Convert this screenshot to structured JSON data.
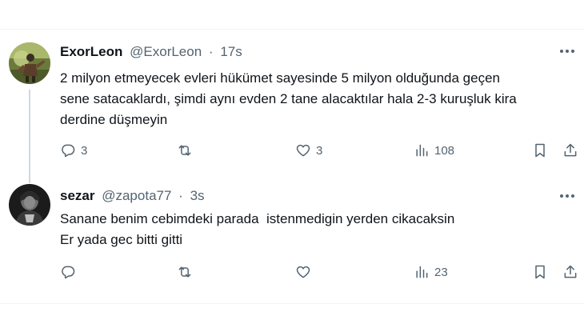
{
  "tweets": [
    {
      "name": "ExorLeon",
      "handle": "@ExorLeon",
      "separator": "·",
      "time": "17s",
      "text_lines": [
        "2 milyon etmeyecek evleri hükümet sayesinde 5 milyon olduğunda geçen",
        "sene satacaklardı, şimdi aynı evden 2 tane alacaktılar hala 2-3 kuruşluk kira",
        "derdine düşmeyin"
      ],
      "replies": "3",
      "retweets": "",
      "likes": "3",
      "views": "108"
    },
    {
      "name": "sezar",
      "handle": "@zapota77",
      "separator": "·",
      "time": "3s",
      "text_lines": [
        "Sanane benim cebimdeki parada  istenmedigin yerden cikacaksin",
        "Er yada gec bitti gitti"
      ],
      "replies": "",
      "retweets": "",
      "likes": "",
      "views": "23"
    }
  ],
  "icons": {
    "reply": "reply-icon",
    "retweet": "retweet-icon",
    "like": "heart-icon",
    "views": "views-icon",
    "bookmark": "bookmark-icon",
    "share": "share-icon",
    "more": "more-icon"
  },
  "colors": {
    "text": "#0f1419",
    "secondary": "#536471",
    "divider": "#eff3f4",
    "thread_line": "#cfd9de"
  }
}
